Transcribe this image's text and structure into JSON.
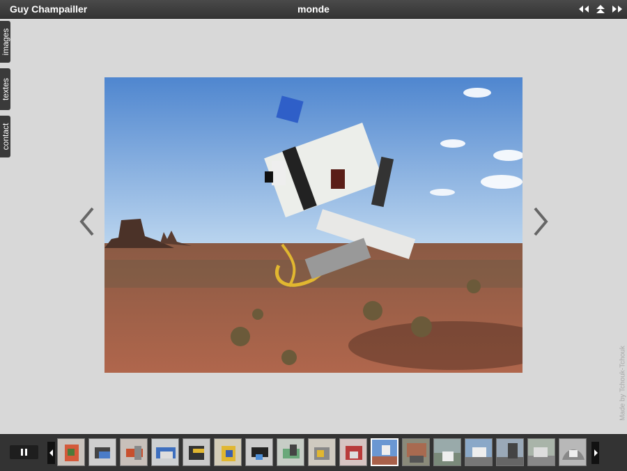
{
  "header": {
    "site_title": "Guy Champailler",
    "gallery_title": "monde",
    "nav_icons": [
      "previous-gallery-icon",
      "gallery-index-icon",
      "next-gallery-icon"
    ]
  },
  "sidebar": {
    "tabs": [
      {
        "name": "images",
        "label": "images"
      },
      {
        "name": "textes",
        "label": "textes"
      },
      {
        "name": "contact",
        "label": "contact"
      }
    ]
  },
  "credit": "Made by Tchouk-Tchouk",
  "filmstrip": {
    "count": 17,
    "active_index": 10
  },
  "colors": {
    "bar": "#333333",
    "background": "#d8d8d8"
  }
}
